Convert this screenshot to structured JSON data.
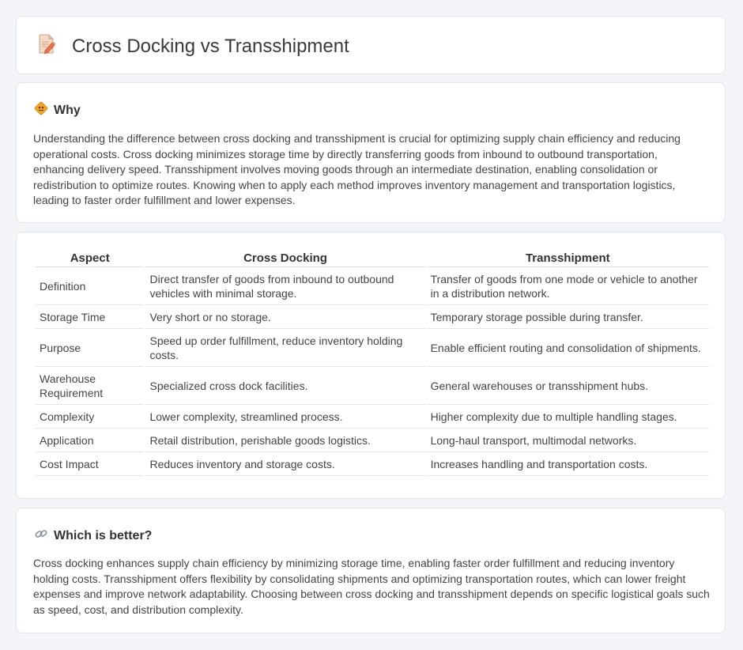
{
  "header": {
    "title": "Cross Docking vs Transshipment",
    "icon": "document-edit-icon"
  },
  "why": {
    "title": "Why",
    "icon": "diamond-sign-icon",
    "text": "Understanding the difference between cross docking and transshipment is crucial for optimizing supply chain efficiency and reducing operational costs. Cross docking minimizes storage time by directly transferring goods from inbound to outbound transportation, enhancing delivery speed. Transshipment involves moving goods through an intermediate destination, enabling consolidation or redistribution to optimize routes. Knowing when to apply each method improves inventory management and transportation logistics, leading to faster order fulfillment and lower expenses."
  },
  "table": {
    "headers": [
      "Aspect",
      "Cross Docking",
      "Transshipment"
    ],
    "rows": [
      [
        "Definition",
        "Direct transfer of goods from inbound to outbound vehicles with minimal storage.",
        "Transfer of goods from one mode or vehicle to another in a distribution network."
      ],
      [
        "Storage Time",
        "Very short or no storage.",
        "Temporary storage possible during transfer."
      ],
      [
        "Purpose",
        "Speed up order fulfillment, reduce inventory holding costs.",
        "Enable efficient routing and consolidation of shipments."
      ],
      [
        "Warehouse Requirement",
        "Specialized cross dock facilities.",
        "General warehouses or transshipment hubs."
      ],
      [
        "Complexity",
        "Lower complexity, streamlined process.",
        "Higher complexity due to multiple handling stages."
      ],
      [
        "Application",
        "Retail distribution, perishable goods logistics.",
        "Long-haul transport, multimodal networks."
      ],
      [
        "Cost Impact",
        "Reduces inventory and storage costs.",
        "Increases handling and transportation costs."
      ]
    ]
  },
  "better": {
    "title": "Which is better?",
    "icon": "link-icon",
    "text": "Cross docking enhances supply chain efficiency by minimizing storage time, enabling faster order fulfillment and reducing inventory holding costs. Transshipment offers flexibility by consolidating shipments and optimizing transportation routes, which can lower freight expenses and improve network adaptability. Choosing between cross docking and transshipment depends on specific logistical goals such as speed, cost, and distribution complexity."
  }
}
